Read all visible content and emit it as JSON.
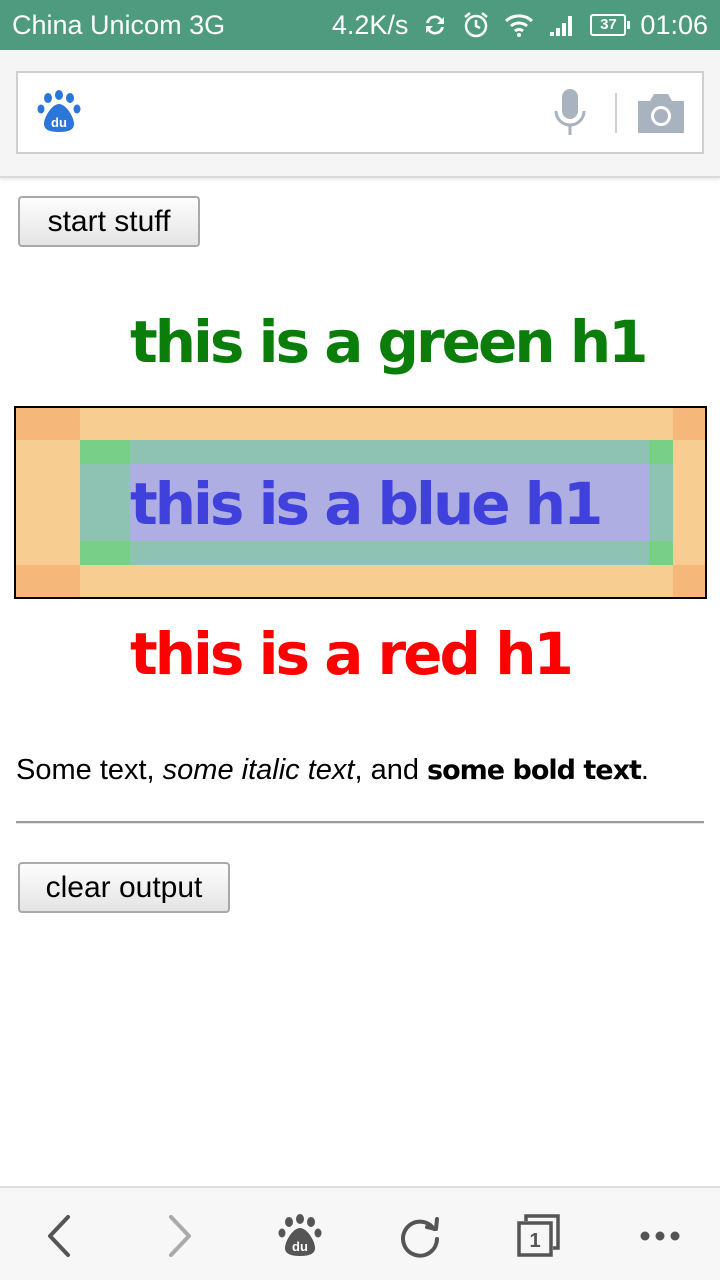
{
  "status_bar": {
    "carrier": "China Unicom 3G",
    "net_speed": "4.2K/s",
    "battery": "37",
    "time": "01:06",
    "icons": [
      "sync-icon",
      "alarm-icon",
      "wifi-icon",
      "signal-icon",
      "battery-icon"
    ]
  },
  "search_bar": {
    "logo": "du",
    "icons": [
      "baidu-paw-logo",
      "microphone-icon",
      "camera-icon"
    ]
  },
  "page": {
    "start_button": "start stuff",
    "green_heading": "this is a green h1",
    "blue_heading": "this is a blue h1",
    "red_heading": "this is a red h1",
    "paragraph": {
      "normal": "Some text, ",
      "italic": "some italic text",
      "middle": ", and ",
      "bold": "some bold text",
      "end": "."
    },
    "clear_button": "clear output"
  },
  "colors": {
    "status_bar": "#4f9b80",
    "green_heading": "#0b7d0b",
    "blue_heading": "#4040dd",
    "red_heading": "#ff0000",
    "margin_highlight": "#f8cd91",
    "border_highlight": "#8ec2b2",
    "padding_highlight": "#78d088",
    "content_highlight": "#aeaee2"
  },
  "bottom_nav": {
    "tab_count": "1",
    "icons": [
      "back-icon",
      "forward-icon",
      "baidu-home-icon",
      "refresh-icon",
      "tabs-icon",
      "more-icon"
    ]
  }
}
